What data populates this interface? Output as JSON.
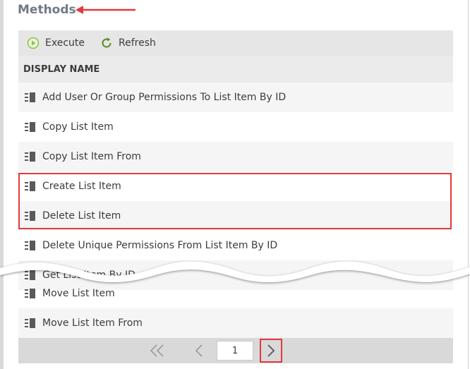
{
  "section": {
    "title": "Methods"
  },
  "toolbar": {
    "execute_label": "Execute",
    "refresh_label": "Refresh"
  },
  "table": {
    "column_header": "DISPLAY NAME",
    "rows": [
      "Add User Or Group Permissions To List Item By ID",
      "Copy List Item",
      "Copy List Item From",
      "Create List Item",
      "Delete List Item",
      "Delete Unique Permissions From List Item By ID",
      "Get List Item By ID",
      "Move List Item",
      "Move List Item From"
    ]
  },
  "pager": {
    "current_page": "1"
  },
  "colors": {
    "highlight": "#e4393c",
    "execute_icon": "#8cc34a",
    "refresh_icon": "#5b8a1e",
    "title": "#707a85"
  },
  "icons": {
    "method": "method-list-icon",
    "execute": "play-circle-icon",
    "refresh": "refresh-icon",
    "first": "double-chevron-left-icon",
    "prev": "chevron-left-icon",
    "next": "chevron-right-icon"
  }
}
